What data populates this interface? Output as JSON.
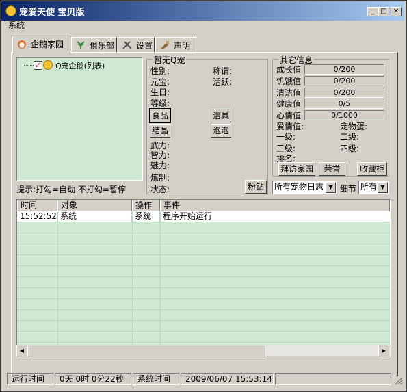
{
  "window": {
    "title": "宠爱天使 宝贝版",
    "icon": "angel-app-icon"
  },
  "menu": {
    "system": "系统"
  },
  "tabs": [
    {
      "label": "企鹅家园",
      "icon": "penguin-home-icon"
    },
    {
      "label": "俱乐部",
      "icon": "club-icon"
    },
    {
      "label": "设置",
      "icon": "tools-icon"
    },
    {
      "label": "声明",
      "icon": "statement-icon"
    }
  ],
  "tree": {
    "root_label": "Q宠企鹅(列表)",
    "checked": true
  },
  "hint": "提示:打勾=自动 不打勾=暂停",
  "pet": {
    "group_title": "暂无Q宠",
    "gender": "性别:",
    "title_label": "称谓:",
    "yuanbao": "元宝:",
    "active": "活跃:",
    "birthday": "生日:",
    "level": "等级:",
    "food_button": "食品",
    "clean_button": "洁具",
    "knot_button": "结晶",
    "bubble_button": "泡泡",
    "strength": "武力:",
    "intelligence": "智力:",
    "charm": "魅力:",
    "craft": "炼制:",
    "status": "状态:",
    "pink_diamond_button": "粉钻"
  },
  "other": {
    "group_title": "其它信息",
    "growth_label": "成长值",
    "growth_value": "0/200",
    "hunger_label": "饥饿值",
    "hunger_value": "0/200",
    "clean_label": "清洁值",
    "clean_value": "0/200",
    "health_label": "健康值",
    "health_value": "0/5",
    "mood_label": "心情值",
    "mood_value": "0/1000",
    "love_label": "爱情值:",
    "egg_label": "宠物蛋:",
    "level1": "一级:",
    "level2": "二级:",
    "level3": "三级:",
    "level4": "四级:",
    "rank": "排名:",
    "visit_button": "拜访家园",
    "honor_button": "荣誉",
    "collection_button": "收藏柜"
  },
  "log_filter": {
    "selected": "所有宠物日志",
    "detail_label": "细节",
    "detail_selected": "所有"
  },
  "log": {
    "columns": [
      "时间",
      "对象",
      "操作",
      "事件"
    ],
    "rows": [
      [
        "15:52:52",
        "系统",
        "系统",
        "程序开始运行"
      ]
    ]
  },
  "statusbar": {
    "runtime_label": "运行时间",
    "runtime_value": "0天 0时 0分22秒",
    "systime_label": "系统时间",
    "systime_value": "2009/06/07 15:53:14"
  }
}
